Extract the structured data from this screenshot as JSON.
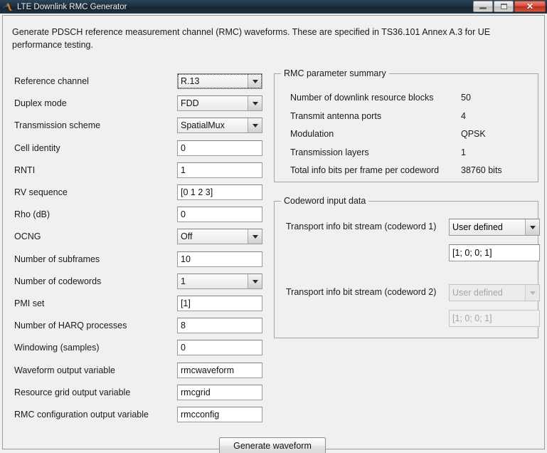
{
  "window": {
    "title": "LTE Downlink RMC Generator",
    "app_icon": "matlab-icon",
    "controls": {
      "minimize": "minimize-icon",
      "maximize": "maximize-icon",
      "close": "✕"
    }
  },
  "description": "Generate PDSCH reference measurement channel (RMC) waveforms. These are specified in TS36.101 Annex A.3 for UE performance testing.",
  "form": {
    "fields": [
      {
        "label": "Reference channel",
        "type": "combo",
        "value": "R.13",
        "focused": true
      },
      {
        "label": "Duplex mode",
        "type": "combo",
        "value": "FDD",
        "focused": false
      },
      {
        "label": "Transmission scheme",
        "type": "combo",
        "value": "SpatialMux",
        "focused": false
      },
      {
        "label": "Cell identity",
        "type": "text",
        "value": "0",
        "focused": false
      },
      {
        "label": "RNTI",
        "type": "text",
        "value": "1",
        "focused": false
      },
      {
        "label": "RV sequence",
        "type": "text",
        "value": "[0  1  2  3]",
        "focused": false
      },
      {
        "label": "Rho (dB)",
        "type": "text",
        "value": "0",
        "focused": false
      },
      {
        "label": "OCNG",
        "type": "combo",
        "value": "Off",
        "focused": false
      },
      {
        "label": "Number of subframes",
        "type": "text",
        "value": "10",
        "focused": false
      },
      {
        "label": "Number of codewords",
        "type": "combo",
        "value": "1",
        "focused": false
      },
      {
        "label": "PMI set",
        "type": "text",
        "value": "[1]",
        "focused": false
      },
      {
        "label": "Number of HARQ processes",
        "type": "text",
        "value": "8",
        "focused": false
      },
      {
        "label": "Windowing (samples)",
        "type": "text",
        "value": "0",
        "focused": false
      },
      {
        "label": "Waveform output variable",
        "type": "text",
        "value": "rmcwaveform",
        "focused": false
      },
      {
        "label": "Resource grid output variable",
        "type": "text",
        "value": "rmcgrid",
        "focused": false
      },
      {
        "label": "RMC configuration output variable",
        "type": "text",
        "value": "rmcconfig",
        "focused": false
      }
    ]
  },
  "summary_panel": {
    "title": "RMC parameter summary",
    "rows": [
      {
        "label": "Number of downlink resource blocks",
        "value": "50"
      },
      {
        "label": "Transmit antenna ports",
        "value": "4"
      },
      {
        "label": "Modulation",
        "value": "QPSK"
      },
      {
        "label": "Transmission layers",
        "value": "1"
      },
      {
        "label": "Total info bits per frame per codeword",
        "value": "38760 bits"
      }
    ]
  },
  "codeword_panel": {
    "title": "Codeword input data",
    "codeword1": {
      "label": "Transport info bit stream (codeword 1)",
      "source": "User defined",
      "bits": "[1; 0; 0; 1]",
      "enabled": true
    },
    "codeword2": {
      "label": "Transport info bit stream (codeword 2)",
      "source": "User defined",
      "bits": "[1; 0; 0; 1]",
      "enabled": false
    }
  },
  "actions": {
    "generate_label": "Generate waveform"
  },
  "colors": {
    "titlebar": "#1d2f41",
    "client_bg": "#f0f0f0",
    "close_button": "#c9391f",
    "field_border": "#9a9a9a",
    "disabled_text": "#a5a5a5"
  }
}
